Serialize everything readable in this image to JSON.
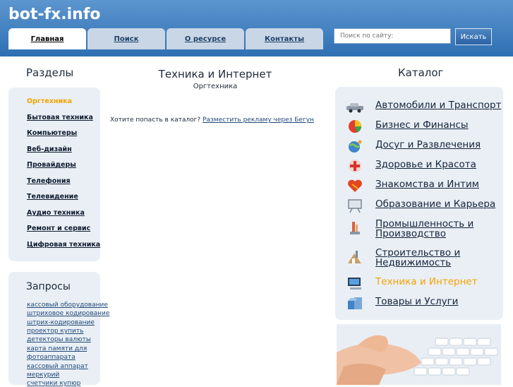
{
  "site": {
    "logo": "bot-fx.info"
  },
  "nav_tabs": [
    {
      "label": "Главная",
      "active": true
    },
    {
      "label": "Поиск",
      "active": false
    },
    {
      "label": "О ресурсе",
      "active": false
    },
    {
      "label": "Контакты",
      "active": false
    }
  ],
  "search": {
    "placeholder": "Поиск по сайту:",
    "button_label": "Искать"
  },
  "sections": {
    "title": "Разделы",
    "items": [
      {
        "label": "Оргтехника",
        "active": true
      },
      {
        "label": "Бытовая техника",
        "active": false
      },
      {
        "label": "Компьютеры",
        "active": false
      },
      {
        "label": "Веб-дизайн",
        "active": false
      },
      {
        "label": "Провайдеры",
        "active": false
      },
      {
        "label": "Телефония",
        "active": false
      },
      {
        "label": "Телевидение",
        "active": false
      },
      {
        "label": "Аудио техника",
        "active": false
      },
      {
        "label": "Ремонт и сервис",
        "active": false
      },
      {
        "label": "Цифровая техника",
        "active": false
      }
    ]
  },
  "queries": {
    "title": "Запросы",
    "items": [
      "кассовый оборудование",
      "штриховое кодирование",
      "штрих-кодирование",
      "проектор купить",
      "детекторы валюты",
      "карта памяти для",
      "фотоаппарата",
      "кассовый аппарат",
      "меркурий",
      "счетчики купюр"
    ]
  },
  "main": {
    "title": "Техника и Интернет",
    "subtitle": "Оргтехника",
    "message_prefix": "Хотите попасть в каталог?",
    "message_link": "Разместить рекламу через Бегун"
  },
  "catalog": {
    "title": "Каталог",
    "items": [
      {
        "line1": "Автомобили и Транспорт",
        "line2": "",
        "icon": "car-icon",
        "active": false
      },
      {
        "line1": "Бизнес и Финансы",
        "line2": "",
        "icon": "pie-chart-icon",
        "active": false
      },
      {
        "line1": "Досуг и Развлечения",
        "line2": "",
        "icon": "globe-icon",
        "active": false
      },
      {
        "line1": "Здоровье и Красота",
        "line2": "",
        "icon": "health-icon",
        "active": false
      },
      {
        "line1": "Знакомства и Интим",
        "line2": "",
        "icon": "heart-icon",
        "active": false
      },
      {
        "line1": "Образование и Карьера",
        "line2": "",
        "icon": "board-icon",
        "active": false
      },
      {
        "line1": "Промышленность и",
        "line2": "Производство",
        "icon": "factory-icon",
        "active": false
      },
      {
        "line1": "Строительство и",
        "line2": "Недвижимость",
        "icon": "building-icon",
        "active": false
      },
      {
        "line1": "Техника и Интернет",
        "line2": "",
        "icon": "computer-icon",
        "active": true
      },
      {
        "line1": "Товары и Услуги",
        "line2": "",
        "icon": "goods-icon",
        "active": false
      }
    ]
  },
  "colors": {
    "header": "#2e6fb3",
    "accent": "#f4a300",
    "panel": "#e9eff5",
    "link": "#214a7a"
  }
}
